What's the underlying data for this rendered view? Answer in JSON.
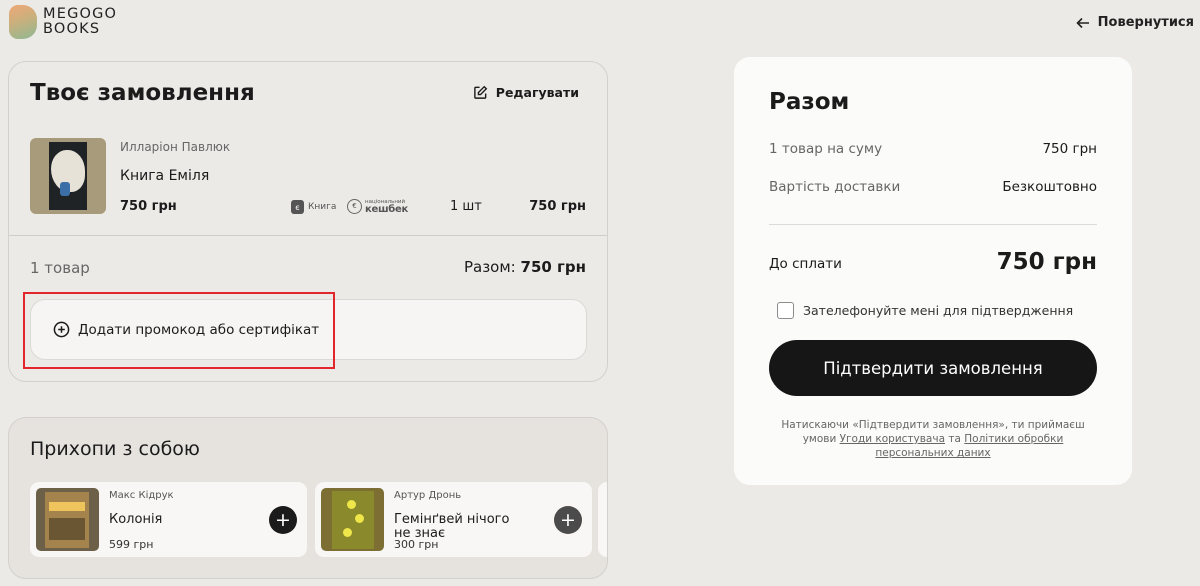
{
  "header": {
    "logo_line1": "MEGOGO",
    "logo_line2": "BOOKS",
    "back_label": "Повернутися"
  },
  "order": {
    "title": "Твоє замовлення",
    "edit_label": "Редагувати",
    "item": {
      "author": "Илларіон Павлюк",
      "name": "Книга Еміля",
      "price": "750 грн",
      "badge_kniga": "Книга",
      "badge_cash_top": "національний",
      "badge_cash_bottom": "кешбек",
      "quantity": "1 шт",
      "total": "750 грн"
    },
    "count_label": "1 товар",
    "sum_prefix": "Разом:",
    "sum_value": "750 грн",
    "promo_label": "Додати промокод або сертифікат"
  },
  "take_along": {
    "title": "Прихопи з собою",
    "products": [
      {
        "author": "Макс Кідрук",
        "name": "Колонія",
        "price": "599 грн"
      },
      {
        "author": "Артур Дронь",
        "name": "Гемінґвей нічого не знає",
        "price": "300 грн"
      }
    ]
  },
  "summary": {
    "title": "Разом",
    "rows": [
      {
        "label": "1 товар на суму",
        "value": "750 грн"
      },
      {
        "label": "Вартість доставки",
        "value": "Безкоштовно"
      }
    ],
    "pay_label": "До сплати",
    "pay_value": "750 грн",
    "callback_label": "Зателефонуйте мені для підтвердження",
    "callback_checked": false,
    "confirm_label": "Підтвердити замовлення",
    "terms_pre": "Натискаючи «Підтвердити замовлення», ти приймаєш умови",
    "terms_link1": "Угоди користувача",
    "terms_mid": "та",
    "terms_link2": "Політики обробки персональних даних"
  },
  "colors": {
    "background": "#eceae7",
    "button_dark": "#161616",
    "highlight": "#e3262c"
  }
}
